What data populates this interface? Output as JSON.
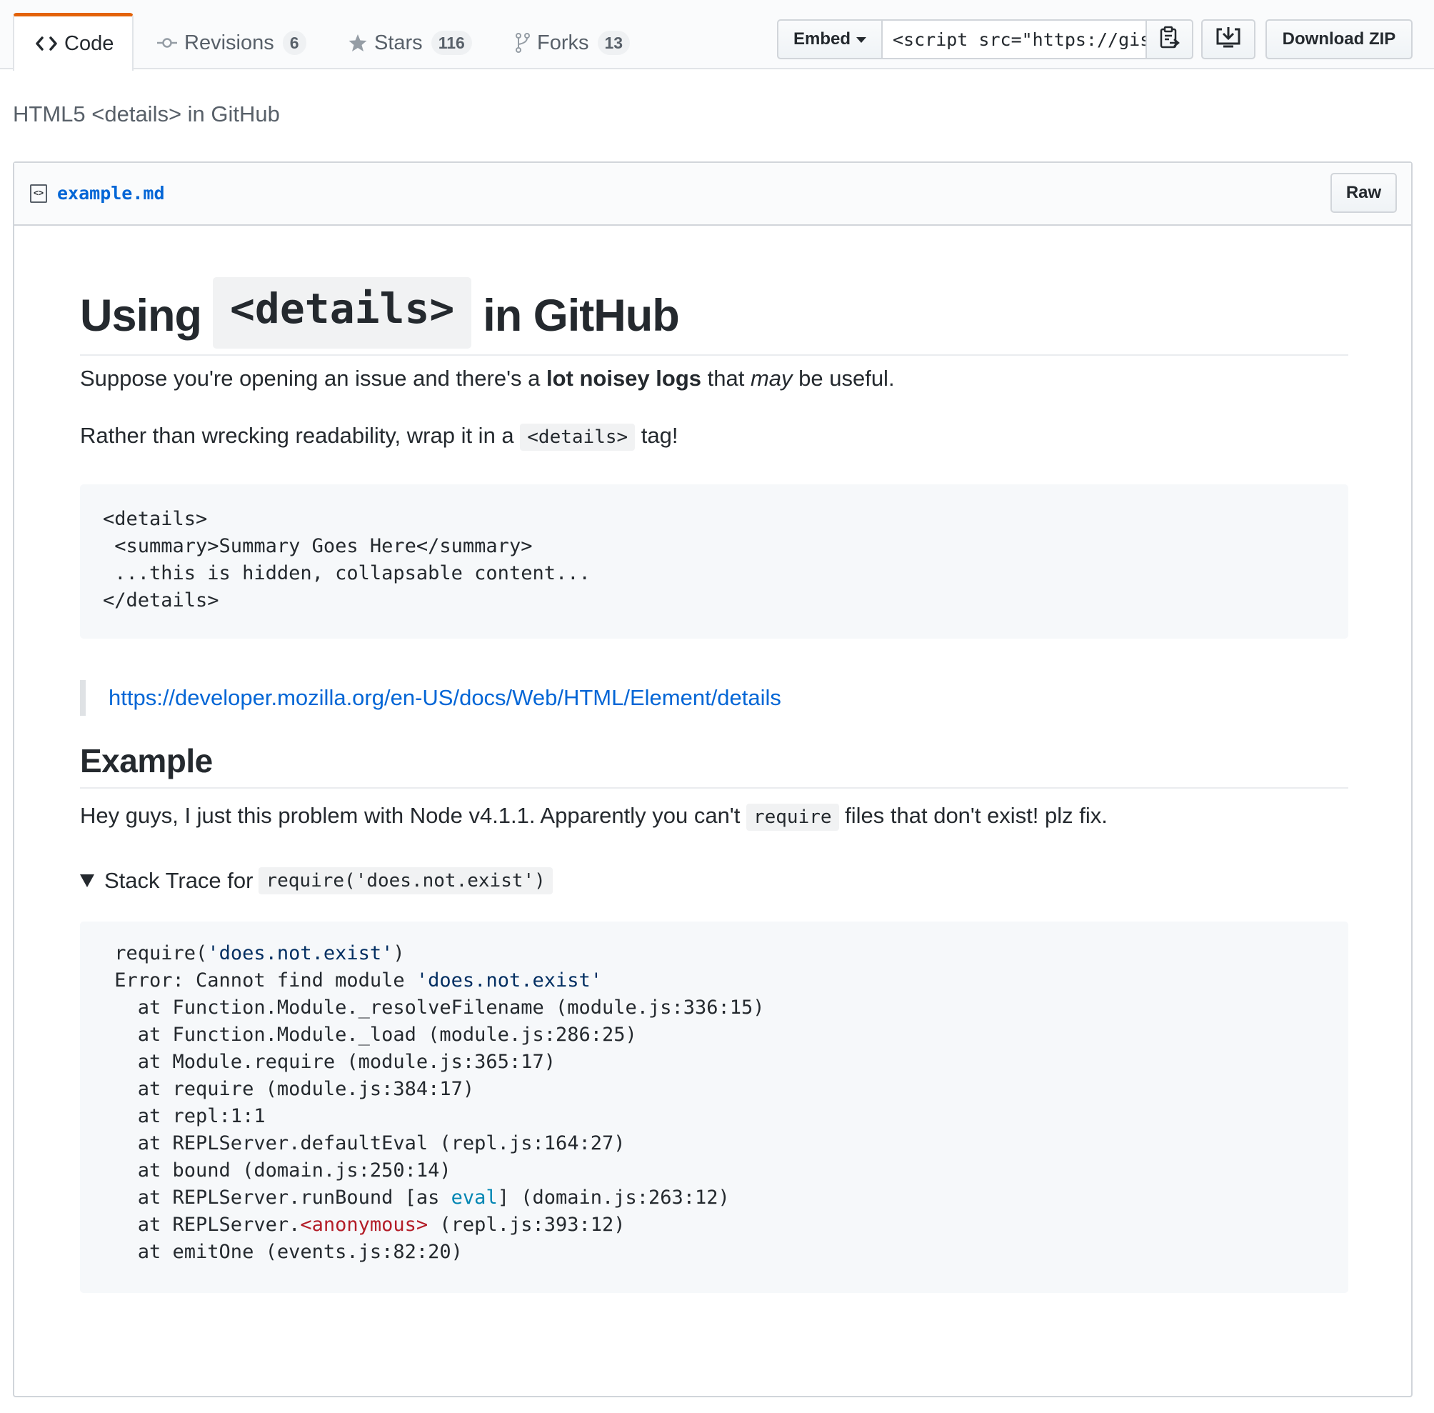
{
  "tabs": [
    {
      "label": "Code",
      "icon": "code-icon"
    },
    {
      "label": "Revisions",
      "count": "6",
      "icon": "git-commit-icon"
    },
    {
      "label": "Stars",
      "count": "116",
      "icon": "star-icon"
    },
    {
      "label": "Forks",
      "count": "13",
      "icon": "repo-forked-icon"
    }
  ],
  "toolbar": {
    "embed_label": "Embed",
    "embed_value": "<script src=\"https://gis",
    "download_zip_label": "Download ZIP"
  },
  "gist": {
    "description": "HTML5 <details> in GitHub"
  },
  "file": {
    "name": "example.md",
    "raw_label": "Raw"
  },
  "content": {
    "h1_before": "Using",
    "h1_code": "<details>",
    "h1_after": "in GitHub",
    "p1_a": "Suppose you're opening an issue and there's a ",
    "p1_bold": "lot noisey logs",
    "p1_b": " that ",
    "p1_italic": "may",
    "p1_c": " be useful.",
    "p2_a": "Rather than wrecking readability, wrap it in a ",
    "p2_code": "<details>",
    "p2_b": " tag!",
    "code_block": [
      "<details>",
      " <summary>Summary Goes Here</summary>",
      " ...this is hidden, collapsable content...",
      "</details>"
    ],
    "link": "https://developer.mozilla.org/en-US/docs/Web/HTML/Element/details",
    "h2": "Example",
    "p3_a": "Hey guys, I just this problem with Node v4.1.1. Apparently you can't ",
    "p3_code": "require",
    "p3_b": " files that don't exist! plz fix.",
    "summary_text": "Stack Trace for ",
    "summary_code": "require('does.not.exist')",
    "trace": {
      "l1_a": " require(",
      "l1_str": "'does.not.exist'",
      "l1_b": ")",
      "l2_a": " Error: Cannot find module ",
      "l2_str": "'does.not.exist'",
      "l3": "   at Function.Module._resolveFilename (module.js:336:15)",
      "l4": "   at Function.Module._load (module.js:286:25)",
      "l5": "   at Module.require (module.js:365:17)",
      "l6": "   at require (module.js:384:17)",
      "l7": "   at repl:1:1",
      "l8": "   at REPLServer.defaultEval (repl.js:164:27)",
      "l9": "   at bound (domain.js:250:14)",
      "l10_a": "   at REPLServer.runBound [as ",
      "l10_kw": "eval",
      "l10_b": "] (domain.js:263:12)",
      "l11_a": "   at REPLServer.",
      "l11_tag": "<anonymous>",
      "l11_b": " (repl.js:393:12)",
      "l12": "   at emitOne (events.js:82:20)"
    }
  },
  "colors": {
    "selected_tab_accent": "#e36209",
    "link": "#0366d6",
    "string": "#032f62",
    "keyword": "#0086b3",
    "tag": "#b31d28"
  }
}
